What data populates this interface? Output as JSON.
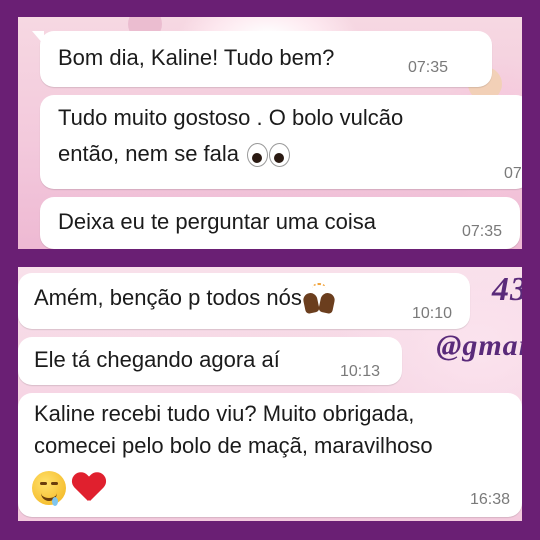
{
  "top_chat": {
    "messages": [
      {
        "text": "Bom dia, Kaline! Tudo bem?",
        "time": "07:35"
      },
      {
        "line1": "Tudo muito gostoso . O bolo vulcão",
        "line2": "então, nem se fala",
        "emoji": "eyes-emoji",
        "time": "07"
      },
      {
        "text": "Deixa eu te perguntar uma coisa",
        "time": "07:35"
      }
    ]
  },
  "bottom_chat": {
    "background_text": {
      "line1": "43",
      "line2": "@gmai"
    },
    "messages": [
      {
        "text": "Amém, benção p todos nós",
        "emoji": "raising-hands-emoji",
        "time": "10:10"
      },
      {
        "text": "Ele tá chegando agora aí",
        "time": "10:13"
      },
      {
        "line1": "Kaline recebi tudo viu? Muito obrigada,",
        "line2": "comecei pelo bolo de maçã, maravilhoso",
        "emojis": [
          "drooling-face-emoji",
          "red-heart-emoji"
        ],
        "time": "16:38"
      }
    ]
  },
  "colors": {
    "frame": "#6a1f74",
    "bubble": "#ffffff",
    "time": "#7a7a7a"
  }
}
